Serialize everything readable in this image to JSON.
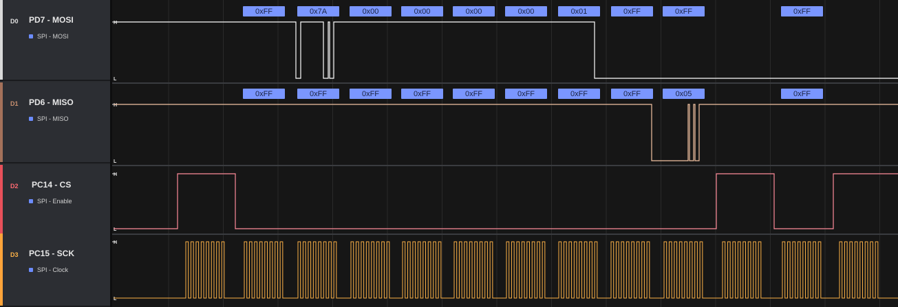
{
  "channels": [
    {
      "num": "D0",
      "name": "PD7 - MOSI",
      "analyzer": "SPI - MOSI",
      "color": "#ffffff",
      "stripe": "#d9d9d9",
      "num_color": "#e0e0e0",
      "level_high": "H",
      "level_low": "L",
      "bytes": [
        "0xFF",
        "0x7A",
        "0x00",
        "0x00",
        "0x00",
        "0x00",
        "0x01",
        "0xFF",
        "0xFF",
        "0xFF"
      ]
    },
    {
      "num": "D1",
      "name": "PD6 - MISO",
      "analyzer": "SPI - MISO",
      "color": "#f4c4a2",
      "stripe": "#a4715a",
      "num_color": "#c89070",
      "level_high": "H",
      "level_low": "L",
      "bytes": [
        "0xFF",
        "0xFF",
        "0xFF",
        "0xFF",
        "0xFF",
        "0xFF",
        "0xFF",
        "0xFF",
        "0x05",
        "0xFF"
      ]
    },
    {
      "num": "D2",
      "name": "PC14 - CS",
      "analyzer": "SPI - Enable",
      "color": "#ff8c9a",
      "stripe": "#e8505a",
      "num_color": "#ff6a72",
      "level_high": "H",
      "level_low": "L",
      "bytes": []
    },
    {
      "num": "D3",
      "name": "PC15 - SCK",
      "analyzer": "SPI - Clock",
      "color": "#ffb347",
      "stripe": "#ffa43a",
      "num_color": "#ffb347",
      "level_high": "H",
      "level_low": "L",
      "bytes": []
    }
  ],
  "colors": {
    "background": "#161616",
    "grid": "#2a2a2a",
    "byte_badge": "#7a96ff",
    "analyzer_dot": "#6c8cff"
  }
}
